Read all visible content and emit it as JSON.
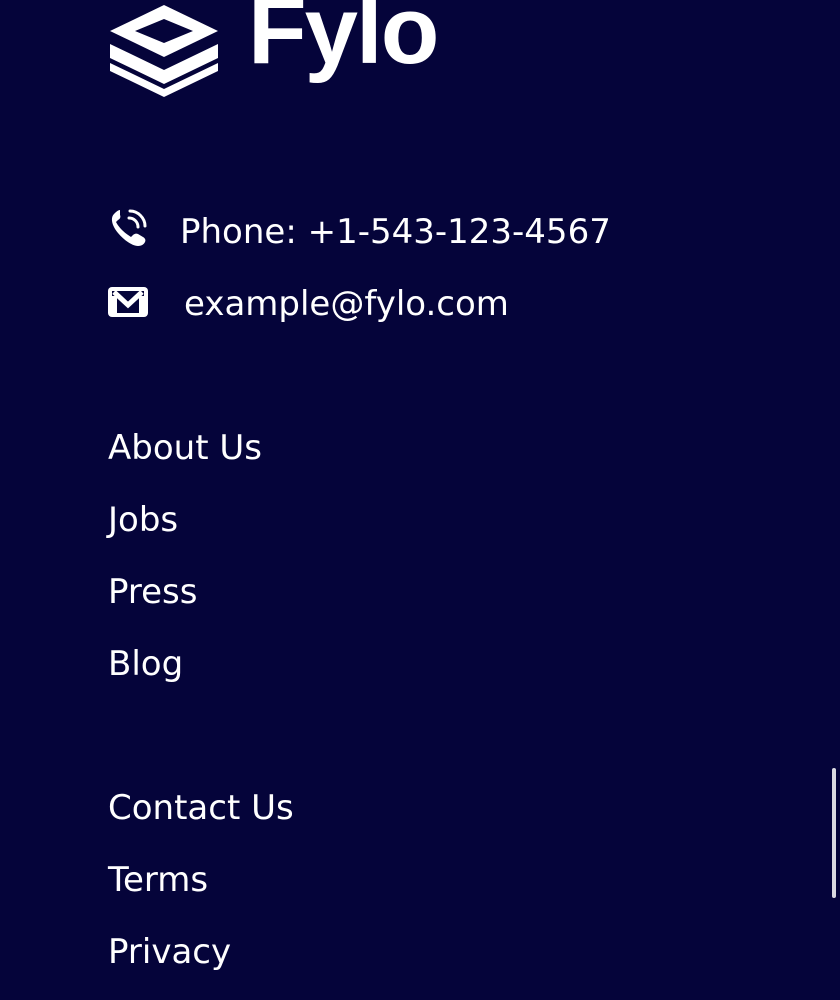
{
  "brand": {
    "name": "Fylo",
    "logo_icon": "stacked-layers-icon"
  },
  "contact": {
    "phone": {
      "icon": "phone-icon",
      "text": "Phone: +1-543-123-4567"
    },
    "email": {
      "icon": "mail-icon",
      "text": "example@fylo.com"
    }
  },
  "links": {
    "group1": [
      "About Us",
      "Jobs",
      "Press",
      "Blog"
    ],
    "group2": [
      "Contact Us",
      "Terms",
      "Privacy"
    ]
  },
  "colors": {
    "background": "#05043a",
    "text": "#ffffff"
  }
}
